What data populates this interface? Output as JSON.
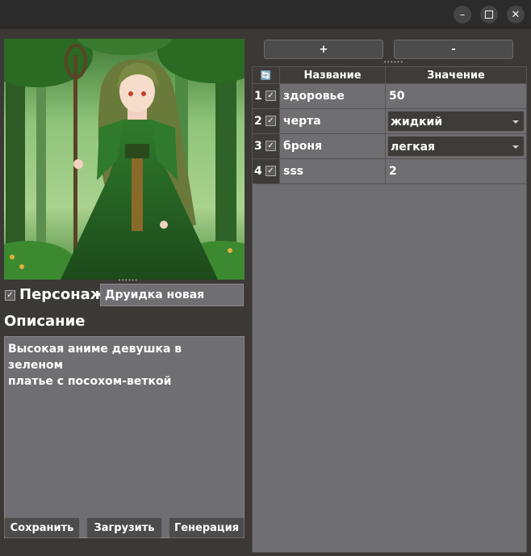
{
  "character": {
    "checkbox_mark": "✓",
    "label": "Персонаж",
    "name_value": "Друидка новая"
  },
  "description": {
    "title": "Описание",
    "text": "Высокая аниме девушка в зеленом\nплатье с посохом-веткой"
  },
  "buttons": {
    "save": "Сохранить",
    "load": "Загрузить",
    "generate": "Генерация",
    "add": "+",
    "remove": "-"
  },
  "table": {
    "refresh_icon": "🔄",
    "col_name": "Название",
    "col_value": "Значение",
    "rows": [
      {
        "num": "1",
        "checked": "✓",
        "name": "здоровье",
        "value": "50",
        "type": "text"
      },
      {
        "num": "2",
        "checked": "✓",
        "name": "черта",
        "value": "жидкий",
        "type": "combo"
      },
      {
        "num": "3",
        "checked": "✓",
        "name": "броня",
        "value": "легкая",
        "type": "combo"
      },
      {
        "num": "4",
        "checked": "✓",
        "name": "sss",
        "value": "2",
        "type": "text"
      }
    ]
  },
  "colors": {
    "panel_bg": "#3c3836",
    "field_bg": "#6f6e72",
    "dress_green": "#2f7a2c"
  }
}
